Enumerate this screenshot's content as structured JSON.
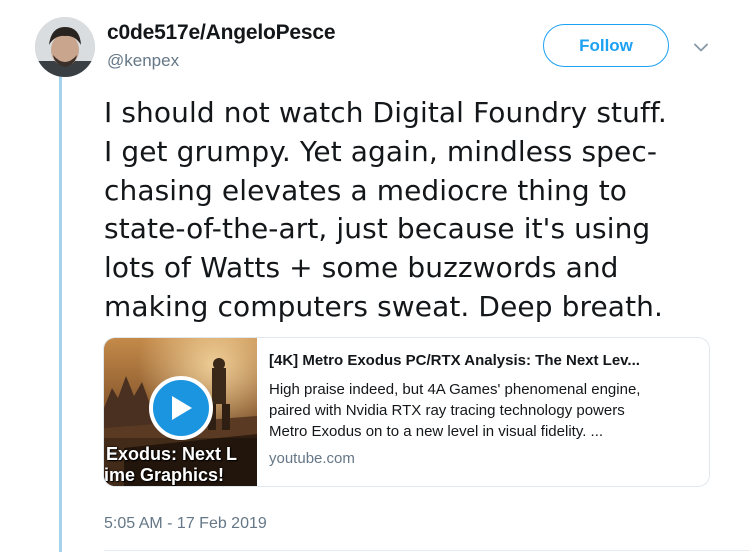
{
  "tweet": {
    "author": {
      "display_name": "c0de517e/AngeloPesce",
      "handle": "@kenpex",
      "avatar_icon": "user-avatar"
    },
    "follow_label": "Follow",
    "more_icon": "chevron-down-icon",
    "text": "I should not watch Digital Foundry stuff.\nI get grumpy. Yet again, mindless spec-\nchasing elevates a mediocre thing to\nstate-of-the-art, just because it's using\nlots of Watts + some buzzwords and\nmaking computers sweat. Deep breath.",
    "timestamp": "5:05 AM - 17 Feb 2019"
  },
  "card": {
    "thumbnail": {
      "caption_line1": "Exodus: Next L",
      "caption_line2": "ime Graphics!",
      "play_icon": "play-icon"
    },
    "title": "[4K] Metro Exodus PC/RTX Analysis: The Next Lev...",
    "description": "High praise indeed, but 4A Games' phenomenal engine,\npaired with Nvidia RTX ray tracing technology powers\nMetro Exodus on to a new level in visual fidelity. ...",
    "domain": "youtube.com"
  },
  "colors": {
    "accent": "#1da1f2",
    "play_button": "#1b95e0",
    "thread_line": "#a6d3ec",
    "secondary_text": "#657786",
    "border": "#e1e8ed"
  }
}
